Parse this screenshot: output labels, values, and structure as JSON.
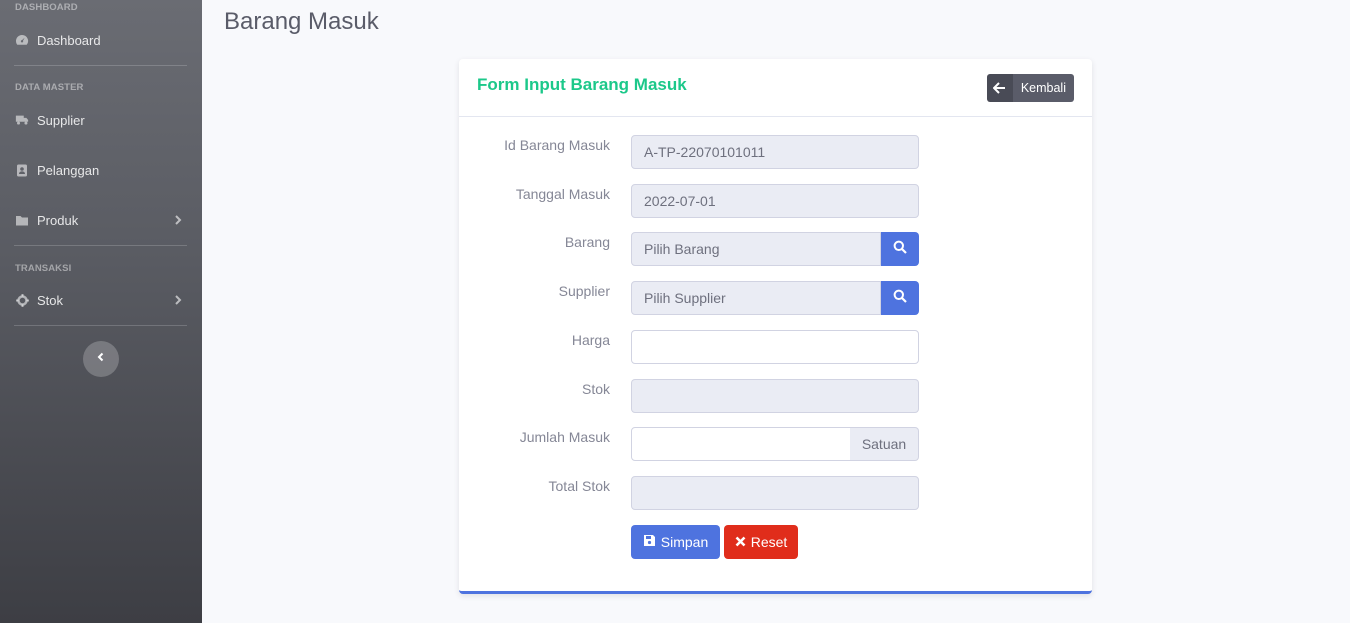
{
  "sidebar": {
    "heading_dashboard": "DASHBOARD",
    "dashboard": "Dashboard",
    "heading_master": "DATA MASTER",
    "supplier": "Supplier",
    "pelanggan": "Pelanggan",
    "produk": "Produk",
    "heading_transaksi": "TRANSAKSI",
    "stok": "Stok"
  },
  "page": {
    "title": "Barang Masuk"
  },
  "form": {
    "title": "Form Input Barang Masuk",
    "back_label": "Kembali",
    "id_label": "Id Barang Masuk",
    "id_value": "A-TP-22070101011",
    "tanggal_label": "Tanggal Masuk",
    "tanggal_value": "2022-07-01",
    "barang_label": "Barang",
    "barang_placeholder": "Pilih Barang",
    "supplier_label": "Supplier",
    "supplier_placeholder": "Pilih Supplier",
    "harga_label": "Harga",
    "harga_value": "",
    "stok_label": "Stok",
    "stok_value": "",
    "jumlah_label": "Jumlah Masuk",
    "jumlah_value": "",
    "jumlah_addon": "Satuan",
    "total_label": "Total Stok",
    "total_value": "",
    "save_label": "Simpan",
    "reset_label": "Reset"
  },
  "colors": {
    "primary": "#4e73df",
    "success": "#1cc88a",
    "danger": "#e02d1b",
    "secondary": "#5a5c69"
  }
}
